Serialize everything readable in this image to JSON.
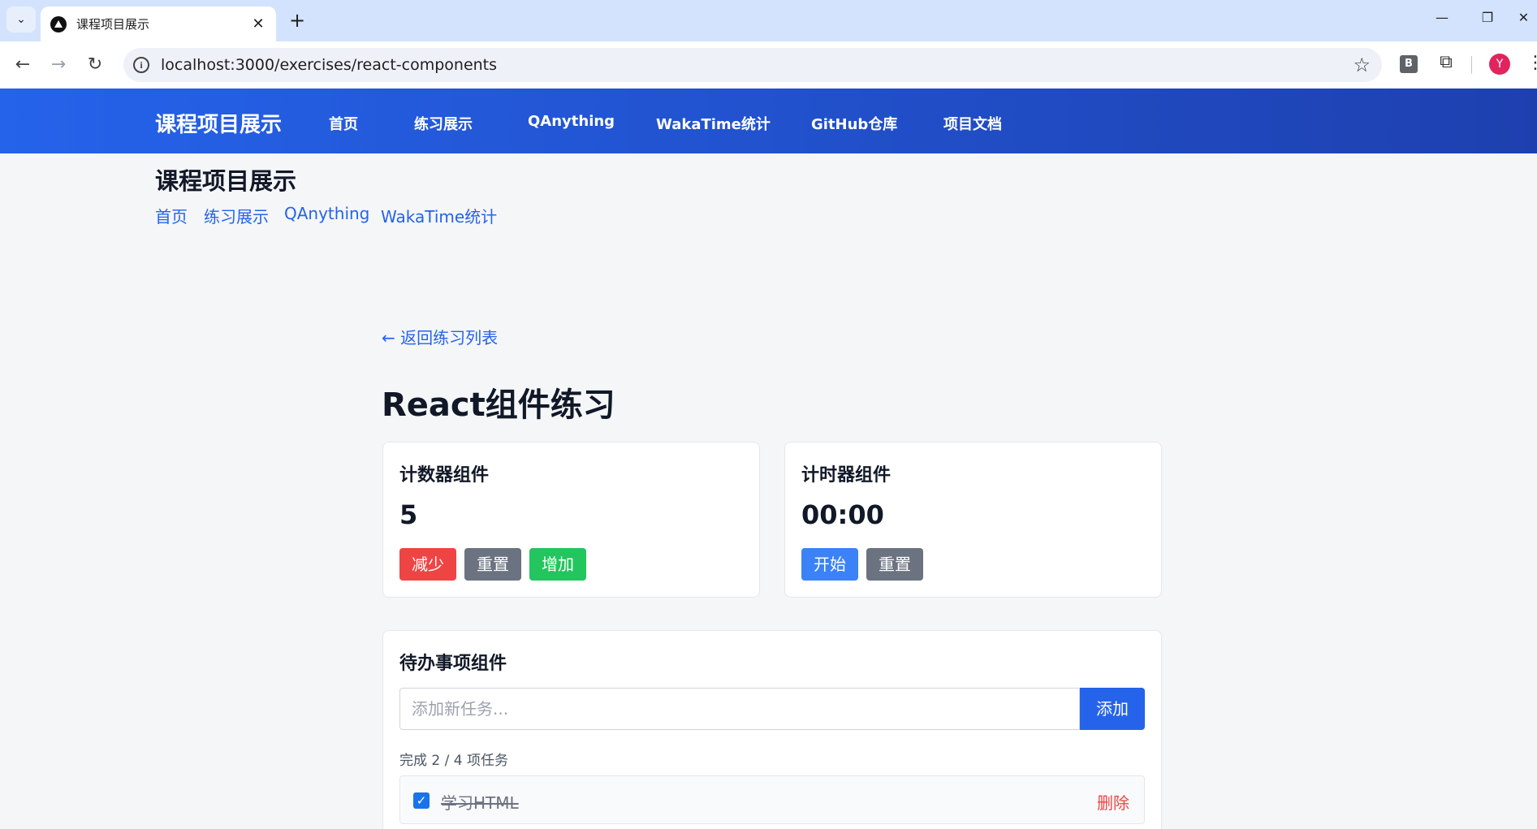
{
  "browser": {
    "tab_title": "课程项目展示",
    "tab_close": "✕",
    "new_tab": "+",
    "url": "localhost:3000/exercises/react-components",
    "profile_initial": "Y",
    "extension_letter": "B"
  },
  "site": {
    "brand": "课程项目展示",
    "nav": [
      "首页",
      "练习展示",
      "QAnything",
      "WakaTime统计",
      "GitHub仓库",
      "项目文档"
    ],
    "accent_color": "#2563eb"
  },
  "sub_header": {
    "title": "课程项目展示",
    "links": [
      "首页",
      "练习展示",
      "QAnything",
      "WakaTime统计"
    ]
  },
  "main": {
    "back_link": "← 返回练习列表",
    "title": "React组件练习",
    "counter": {
      "title": "计数器组件",
      "value": "5",
      "buttons": [
        "减少",
        "重置",
        "增加"
      ]
    },
    "timer": {
      "title": "计时器组件",
      "value": "00:00",
      "buttons": [
        "开始",
        "重置"
      ]
    },
    "todo": {
      "title": "待办事项组件",
      "placeholder": "添加新任务...",
      "add_label": "添加",
      "summary": "完成 2 / 4 项任务",
      "items": [
        {
          "text": "学习HTML",
          "done": true,
          "delete_label": "删除"
        }
      ]
    }
  }
}
